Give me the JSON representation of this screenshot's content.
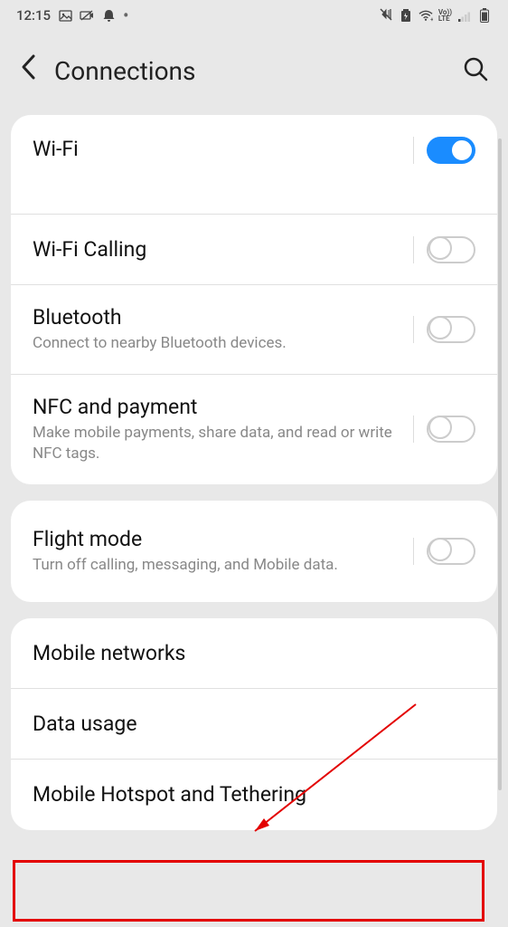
{
  "status": {
    "time": "12:15"
  },
  "header": {
    "title": "Connections"
  },
  "cards": [
    {
      "rows": [
        {
          "title": "Wi-Fi",
          "desc": "",
          "toggle": "on",
          "redacted": true
        },
        {
          "title": "Wi-Fi Calling",
          "desc": "",
          "toggle": "off"
        },
        {
          "title": "Bluetooth",
          "desc": "Connect to nearby Bluetooth devices.",
          "toggle": "off"
        },
        {
          "title": "NFC and payment",
          "desc": "Make mobile payments, share data, and read or write NFC tags.",
          "toggle": "off"
        }
      ]
    },
    {
      "rows": [
        {
          "title": "Flight mode",
          "desc": "Turn off calling, messaging, and Mobile data.",
          "toggle": "off"
        }
      ]
    },
    {
      "rows": [
        {
          "title": "Mobile networks"
        },
        {
          "title": "Data usage"
        },
        {
          "title": "Mobile Hotspot and Tethering"
        }
      ]
    }
  ]
}
